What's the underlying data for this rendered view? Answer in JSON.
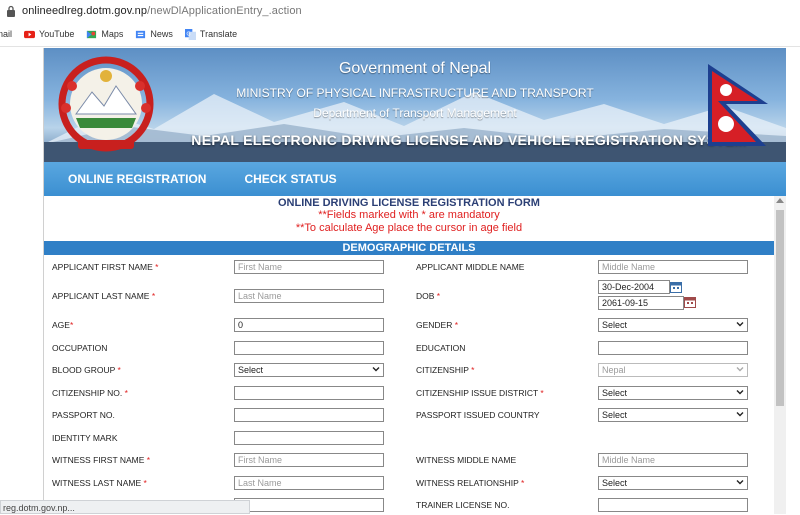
{
  "browser": {
    "url_domain": "onlineedlreg.dotm.gov.np",
    "url_path": "/newDlApplicationEntry_.action",
    "bookmarks": [
      "nail",
      "YouTube",
      "Maps",
      "News",
      "Translate"
    ],
    "status_url": "reg.dotm.gov.np..."
  },
  "banner": {
    "title": "Government of Nepal",
    "ministry": "MINISTRY OF PHYSICAL INFRASTRUCTURE AND TRANSPORT",
    "department": "Department of Transport Management",
    "system": "NEPAL ELECTRONIC DRIVING LICENSE AND VEHICLE REGISTRATION SYSTEM"
  },
  "nav": {
    "items": [
      "ONLINE REGISTRATION",
      "CHECK STATUS"
    ]
  },
  "form": {
    "title": "ONLINE DRIVING LICENSE REGISTRATION FORM",
    "note1": "**Fields marked with * are mandatory",
    "note2": "**To calculate Age place the cursor in age field",
    "section": "DEMOGRAPHIC DETAILS",
    "fields": {
      "first_name": {
        "label": "APPLICANT FIRST NAME",
        "placeholder": "First Name"
      },
      "middle_name": {
        "label": "APPLICANT MIDDLE NAME",
        "placeholder": "Middle Name"
      },
      "last_name": {
        "label": "APPLICANT LAST NAME",
        "placeholder": "Last Name"
      },
      "dob": {
        "label": "DOB",
        "ad_value": "30-Dec-2004",
        "bs_value": "2061-09-15"
      },
      "age": {
        "label": "AGE",
        "value": "0"
      },
      "gender": {
        "label": "GENDER",
        "value": "Select"
      },
      "occupation": {
        "label": "OCCUPATION"
      },
      "education": {
        "label": "EDUCATION"
      },
      "blood_group": {
        "label": "BLOOD GROUP",
        "value": "Select"
      },
      "citizenship": {
        "label": "CITIZENSHIP",
        "value": "Nepal"
      },
      "citizenship_no": {
        "label": "CITIZENSHIP NO."
      },
      "citizenship_district": {
        "label": "CITIZENSHIP ISSUE DISTRICT",
        "value": "Select"
      },
      "passport_no": {
        "label": "PASSPORT NO."
      },
      "passport_country": {
        "label": "PASSPORT ISSUED COUNTRY",
        "value": "Select"
      },
      "identity_mark": {
        "label": "IDENTITY MARK"
      },
      "witness_first": {
        "label": "WITNESS FIRST NAME",
        "placeholder": "First Name"
      },
      "witness_middle": {
        "label": "WITNESS MIDDLE NAME",
        "placeholder": "Middle Name"
      },
      "witness_last": {
        "label": "WITNESS LAST NAME",
        "placeholder": "Last Name"
      },
      "witness_relationship": {
        "label": "WITNESS RELATIONSHIP",
        "value": "Select"
      },
      "trainer_license": {
        "label": "TRAINER LICENSE NO."
      }
    }
  },
  "colors": {
    "nav_blue": "#3b8fd1",
    "section_blue": "#2f7fc6",
    "required_red": "#e02020",
    "title_navy": "#2b3f75"
  }
}
